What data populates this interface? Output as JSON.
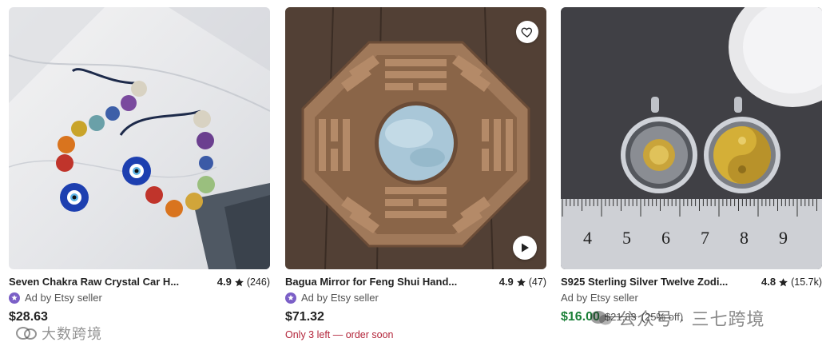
{
  "listings": [
    {
      "title": "Seven Chakra Raw Crystal Car H...",
      "rating": "4.9",
      "review_count": "(246)",
      "ad_label": "Ad by Etsy seller",
      "price": "$28.63",
      "image": "seven-chakra-crystal-car-hanging",
      "favorite_icon": "heart-icon"
    },
    {
      "title": "Bagua Mirror for Feng Shui Hand...",
      "rating": "4.9",
      "review_count": "(47)",
      "ad_label": "Ad by Etsy seller",
      "price": "$71.32",
      "stock_note": "Only 3 left — order soon",
      "image": "bagua-mirror",
      "favorite_icon": "heart-icon",
      "play_icon": "play-icon"
    },
    {
      "title": "S925 Sterling Silver Twelve Zodi...",
      "rating": "4.8",
      "review_count": "(15.7k)",
      "ad_label": "Ad by Etsy seller",
      "price": "$16.00",
      "original_price": "$21.33",
      "discount": "(25% off)",
      "image": "zodiac-pendants-with-ruler",
      "ruler_numbers": [
        "4",
        "5",
        "6",
        "7",
        "8",
        "9"
      ]
    }
  ],
  "watermarks": {
    "left": "大数跨境",
    "right": "公众号 · 三七跨境"
  },
  "colors": {
    "sale_green": "#1a7f37",
    "stock_red": "#b3253a",
    "ad_purple": "#7b5fc7",
    "text": "#222222"
  }
}
